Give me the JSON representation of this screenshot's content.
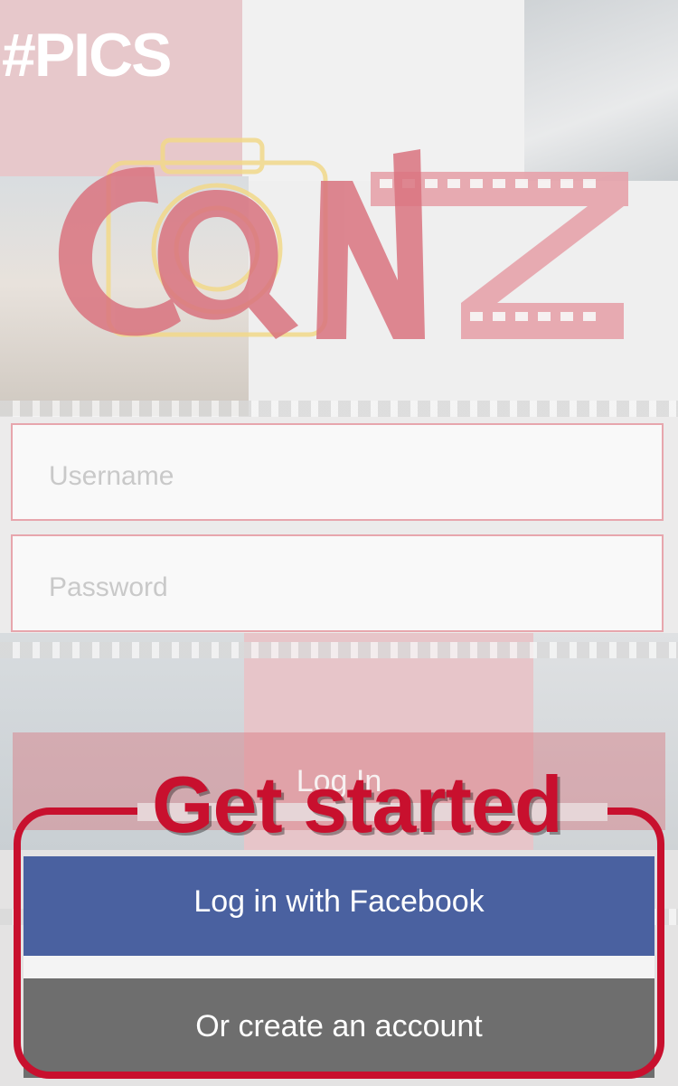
{
  "background": {
    "hashtag": "#PICS"
  },
  "logo": {
    "text": "CQNZ",
    "colors": {
      "letters": "#d9737f",
      "camera": "#f2d98a"
    }
  },
  "form": {
    "username_placeholder": "Username",
    "password_placeholder": "Password"
  },
  "buttons": {
    "login_label": "Log In",
    "facebook_label": "Log in with Facebook",
    "create_label": "Or create an account"
  },
  "annotation": {
    "label": "Get started",
    "color": "#c8102e"
  },
  "colors": {
    "facebook": "#4a61a0",
    "create": "#6e6e6e",
    "login": "#d67780",
    "field_border": "#e7a6ad"
  }
}
